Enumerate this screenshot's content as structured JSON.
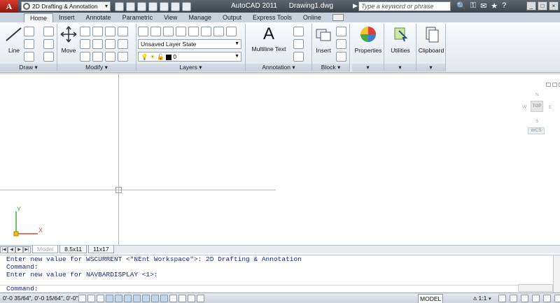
{
  "titlebar": {
    "logo_letter": "A",
    "workspace": "2D Drafting & Annotation",
    "app_name": "AutoCAD 2011",
    "drawing_name": "Drawing1.dwg",
    "search_placeholder": "Type a keyword or phrase"
  },
  "tabs": [
    "Home",
    "Insert",
    "Annotate",
    "Parametric",
    "View",
    "Manage",
    "Output",
    "Express Tools",
    "Online"
  ],
  "ribbon": {
    "draw": {
      "label": "Draw",
      "line": "Line"
    },
    "modify": {
      "label": "Modify",
      "move": "Move"
    },
    "layers": {
      "label": "Layers",
      "layer_state": "Unsaved Layer State",
      "current_layer": "0"
    },
    "annotation": {
      "label": "Annotation",
      "mtext": "Multiline Text"
    },
    "block": {
      "label": "Block",
      "insert": "Insert"
    },
    "properties": {
      "label": "Properties"
    },
    "utilities": {
      "label": "Utilities"
    },
    "clipboard": {
      "label": "Clipboard"
    }
  },
  "viewcube": {
    "n": "N",
    "s": "S",
    "w": "W",
    "e": "E",
    "face": "TOP",
    "wcs": "WCS"
  },
  "ucs": {
    "x": "X",
    "y": "Y"
  },
  "layout_tabs": [
    "Model",
    "8.5x11",
    "11x17"
  ],
  "command": {
    "history": [
      "Enter new value for WSCURRENT <\"NEnt Workspace\">: 2D Drafting & Annotation",
      "Command:",
      "Enter new value for NAVBARDISPLAY <1>:"
    ],
    "prompt": "Command:"
  },
  "status": {
    "coords": "0'-0 35/64\", 0'-0 15/64\", 0'-0\"",
    "model": "MODEL",
    "scale": "1:1"
  },
  "colors": {
    "ucs_x": "#d04a3a",
    "ucs_y": "#3fa93a",
    "crosshair_x": "#e1a8a4",
    "crosshair_y": "#9fcf9a",
    "command_text": "#1d2a8c"
  }
}
